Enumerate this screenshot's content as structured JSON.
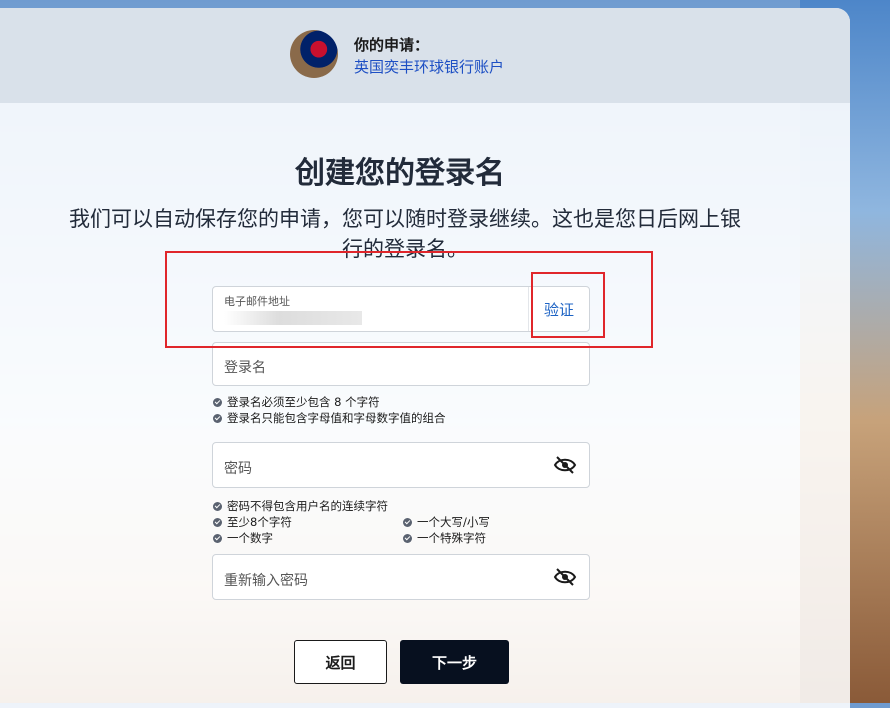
{
  "header": {
    "label": "你的申请：",
    "product": "英国奕丰环球银行账户"
  },
  "main": {
    "title": "创建您的登录名",
    "subtitle": "我们可以自动保存您的申请，您可以随时登录继续。这也是您日后网上银行的登录名。"
  },
  "form": {
    "email": {
      "label": "电子邮件地址",
      "verify_label": "验证"
    },
    "username": {
      "placeholder": "登录名",
      "rules": [
        "登录名必须至少包含 8 个字符",
        "登录名只能包含字母值和字母数字值的组合"
      ]
    },
    "password": {
      "placeholder": "密码",
      "rules": [
        "密码不得包含用户名的连续字符",
        "至少8个字符",
        "一个大写/小写",
        "一个数字",
        "一个特殊字符"
      ]
    },
    "confirm": {
      "placeholder": "重新输入密码"
    }
  },
  "actions": {
    "back_label": "返回",
    "next_label": "下一步"
  },
  "colors": {
    "accent": "#1d4fc4",
    "annotation": "#e0262b",
    "primary_button": "#07101f"
  },
  "icons": [
    "eye-off-icon",
    "check-circle-icon"
  ]
}
